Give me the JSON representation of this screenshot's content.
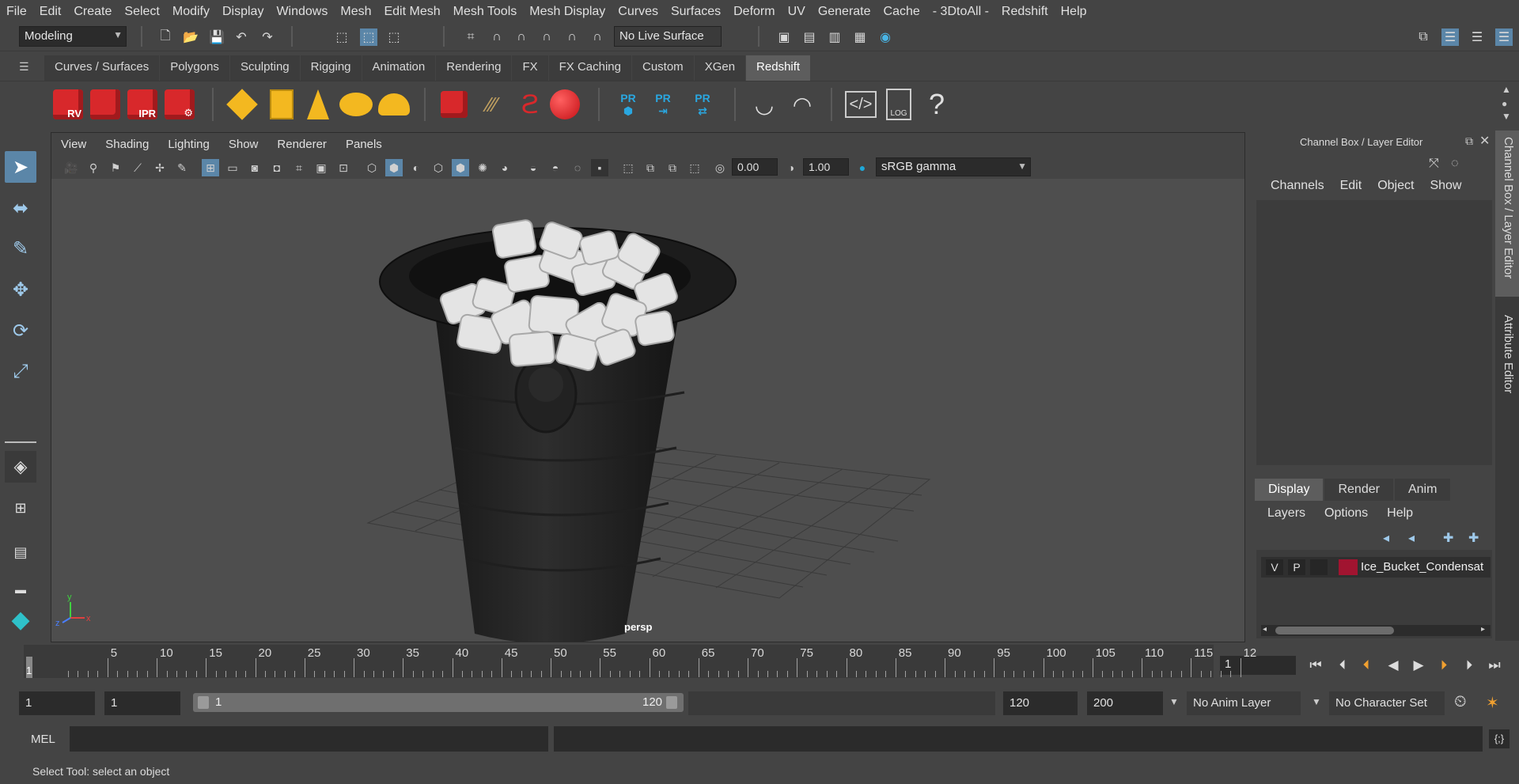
{
  "menu": [
    "File",
    "Edit",
    "Create",
    "Select",
    "Modify",
    "Display",
    "Windows",
    "Mesh",
    "Edit Mesh",
    "Mesh Tools",
    "Mesh Display",
    "Curves",
    "Surfaces",
    "Deform",
    "UV",
    "Generate",
    "Cache",
    "- 3DtoAll -",
    "Redshift",
    "Help"
  ],
  "status": {
    "mode": "Modeling",
    "live_surface": "No Live Surface"
  },
  "shelf": {
    "tabs": [
      "Curves / Surfaces",
      "Polygons",
      "Sculpting",
      "Rigging",
      "Animation",
      "Rendering",
      "FX",
      "FX Caching",
      "Custom",
      "XGen",
      "Redshift"
    ],
    "active_tab": "Redshift",
    "icons": [
      "rv-render-icon",
      "render-icon",
      "ipr-render-icon",
      "render-settings-icon",
      "rs-light-icon",
      "area-light-icon",
      "spot-light-icon",
      "dome-light-icon",
      "sun-sky-icon",
      "proxy-icon",
      "hair-icon",
      "volume-icon",
      "sphere-icon",
      "pr-material-icon",
      "pr-export-icon",
      "pr-sync-icon",
      "bowl-icon",
      "bowl-lid-icon",
      "script-icon",
      "log-icon",
      "help-icon"
    ],
    "labels": {
      "rv": "RV",
      "ipr": "IPR",
      "pr": "PR",
      "log": "LOG"
    }
  },
  "viewport": {
    "menu": [
      "View",
      "Shading",
      "Lighting",
      "Show",
      "Renderer",
      "Panels"
    ],
    "exposure": "0.00",
    "gamma": "1.00",
    "color_space": "sRGB gamma",
    "camera": "persp"
  },
  "channel_box": {
    "title": "Channel Box / Layer Editor",
    "menu": [
      "Channels",
      "Edit",
      "Object",
      "Show"
    ]
  },
  "layer_editor": {
    "tabs": [
      "Display",
      "Render",
      "Anim"
    ],
    "active_tab": "Display",
    "menu": [
      "Layers",
      "Options",
      "Help"
    ],
    "layer": {
      "v": "V",
      "p": "P",
      "name": "Ice_Bucket_Condensat",
      "color": "#a11430"
    }
  },
  "side_tabs": [
    "Channel Box / Layer Editor",
    "Attribute Editor"
  ],
  "timeline": {
    "ticks": [
      "5",
      "10",
      "15",
      "20",
      "25",
      "30",
      "35",
      "40",
      "45",
      "50",
      "55",
      "60",
      "65",
      "70",
      "75",
      "80",
      "85",
      "90",
      "95",
      "100",
      "105",
      "110",
      "115",
      "12"
    ],
    "current_marker": "1",
    "current_frame": "1"
  },
  "range": {
    "start": "1",
    "playback_start": "1",
    "slider_start": "1",
    "slider_end": "120",
    "playback_end": "120",
    "end": "200",
    "anim_layer": "No Anim Layer",
    "character_set": "No Character Set"
  },
  "command": {
    "label": "MEL"
  },
  "help_line": "Select Tool: select an object",
  "axis": {
    "x": "x",
    "y": "y",
    "z": "z"
  }
}
